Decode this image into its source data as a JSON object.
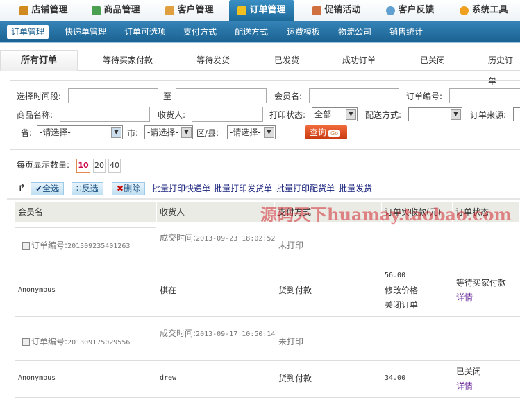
{
  "top_nav": [
    {
      "label": "店铺管理",
      "color": "#d08a20"
    },
    {
      "label": "商品管理",
      "color": "#4aa050"
    },
    {
      "label": "客户管理",
      "color": "#e0a040"
    },
    {
      "label": "订单管理",
      "color": "#f0c020",
      "active": true
    },
    {
      "label": "促销活动",
      "color": "#d07040"
    },
    {
      "label": "客户反馈",
      "color": "#60a0d0"
    },
    {
      "label": "系统工具",
      "color": "#f0a020"
    }
  ],
  "sub_nav": [
    "订单管理",
    "快递单管理",
    "订单可选项",
    "支付方式",
    "配送方式",
    "运费模板",
    "物流公司",
    "销售统计"
  ],
  "tabs": [
    "所有订单",
    "等待买家付款",
    "等待发货",
    "已发货",
    "成功订单",
    "已关闭",
    "历史订单"
  ],
  "filter": {
    "time_label": "选择时间段:",
    "to_label": "至",
    "member_label": "会员名:",
    "order_no_label": "订单编号:",
    "product_label": "商品名称:",
    "receiver_label": "收货人:",
    "print_label": "打印状态:",
    "print_value": "全部",
    "delivery_label": "配送方式:",
    "delivery_value": "",
    "source_label": "订单来源:",
    "province_label": "省:",
    "province_value": "-请选择-",
    "city_label": "市:",
    "city_value": "-请选择-",
    "district_label": "区/县:",
    "district_value": "-请选择-",
    "query_label": "查询",
    "go_label": "Go"
  },
  "per_page": {
    "label": "每页显示数量:",
    "options": [
      "10",
      "20",
      "40"
    ],
    "selected": "10"
  },
  "actions": {
    "select_all": "全选",
    "invert": "反选",
    "delete": "删除",
    "links": [
      "批量打印快递单",
      "批量打印发货单",
      "批量打印配货单",
      "批量发货"
    ]
  },
  "table": {
    "headers": [
      "会员名",
      "收货人",
      "支付方式",
      "订单实收款(元)",
      "订单状态"
    ],
    "orders": [
      {
        "order_no_label": "订单编号:",
        "order_no": "201309235401263",
        "time_label": "成交时间:",
        "time": "2013-09-23 18:02:52",
        "print_status": "未打印",
        "member": "Anonymous",
        "receiver": "棋在",
        "payment": "货到付款",
        "amount": "56.00",
        "ops": [
          "修改价格",
          "关闭订单"
        ],
        "status": "等待买家付款",
        "detail": "详情"
      },
      {
        "order_no_label": "订单编号:",
        "order_no": "201309175029556",
        "time_label": "成交时间:",
        "time": "2013-09-17 10:50:14",
        "print_status": "未打印",
        "member": "Anonymous",
        "receiver": "drew",
        "payment": "货到付款",
        "amount": "34.00",
        "ops": [],
        "status": "已关闭",
        "detail": "详情"
      }
    ]
  },
  "watermark": "源码天下huamay.taobao.com"
}
